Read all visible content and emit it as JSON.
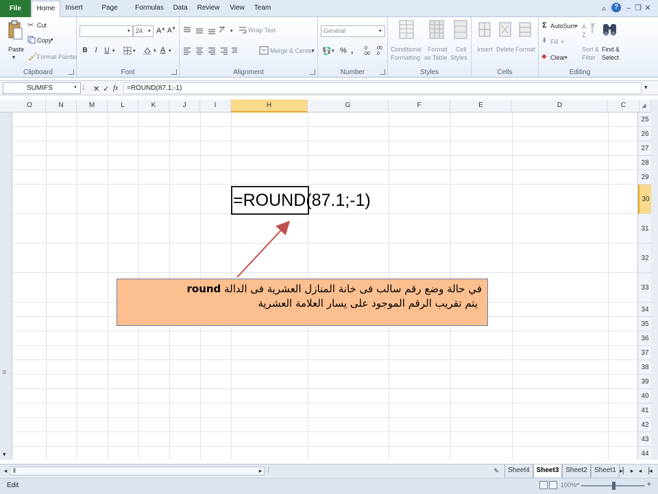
{
  "tabs": {
    "file": "File",
    "home": "Home",
    "insert": "Insert",
    "page_layout": "Page Layout",
    "formulas": "Formulas",
    "data": "Data",
    "review": "Review",
    "view": "View",
    "team": "Team"
  },
  "ribbon": {
    "clipboard": {
      "label": "Clipboard",
      "paste": "Paste",
      "cut": "Cut",
      "copy": "Copy",
      "format_painter": "Format Painter"
    },
    "font": {
      "label": "Font",
      "size": "24",
      "bold": "B",
      "italic": "I",
      "underline": "U"
    },
    "alignment": {
      "label": "Alignment",
      "wrap_text": "Wrap Text",
      "merge_center": "Merge & Center"
    },
    "number": {
      "label": "Number",
      "format": "General",
      "percent": "%",
      "comma": ","
    },
    "styles": {
      "label": "Styles",
      "conditional_formatting_1": "Conditional",
      "conditional_formatting_2": "Formatting",
      "format_table_1": "Format",
      "format_table_2": "as Table",
      "cell_styles_1": "Cell",
      "cell_styles_2": "Styles"
    },
    "cells": {
      "label": "Cells",
      "insert": "Insert",
      "delete": "Delete",
      "format": "Format"
    },
    "editing": {
      "label": "Editing",
      "autosum": "AutoSum",
      "fill": "Fill",
      "clear": "Clear",
      "sort_filter_1": "Sort &",
      "sort_filter_2": "Filter",
      "find_select_1": "Find &",
      "find_select_2": "Select"
    }
  },
  "formula_bar": {
    "name_box": "SUMIFS",
    "cancel": "✕",
    "enter": "✓",
    "fx": "fx",
    "formula": "=ROUND(87.1;-1)"
  },
  "columns": [
    "O",
    "N",
    "M",
    "L",
    "K",
    "J",
    "I",
    "H",
    "G",
    "F",
    "E",
    "D",
    "C"
  ],
  "active_column": "H",
  "rows": [
    "25",
    "26",
    "27",
    "28",
    "29",
    "30",
    "31",
    "32",
    "33",
    "34",
    "35",
    "36",
    "37",
    "38",
    "39",
    "40",
    "41",
    "42",
    "43",
    "44"
  ],
  "active_row": "30",
  "cell": {
    "text": "=ROUND(87.1;-1)"
  },
  "callout": {
    "line1_arabic": "في حالة وضع رقم سالب فى خانة المنازل العشرية فى الدالة",
    "line1_latin": "round",
    "line2": "يتم تقريب الرقم الموجود على يسار العلامة العشرية"
  },
  "sheets": [
    "Sheet4",
    "Sheet3",
    "Sheet2",
    "Sheet1"
  ],
  "active_sheet": "Sheet3",
  "status": {
    "mode": "Edit",
    "zoom": "100%"
  },
  "colors": {
    "file_tab": "#2a7a36",
    "callout_fill": "#fcbf8f",
    "arrow": "#c0504d",
    "active_header": "#f9d98a"
  }
}
